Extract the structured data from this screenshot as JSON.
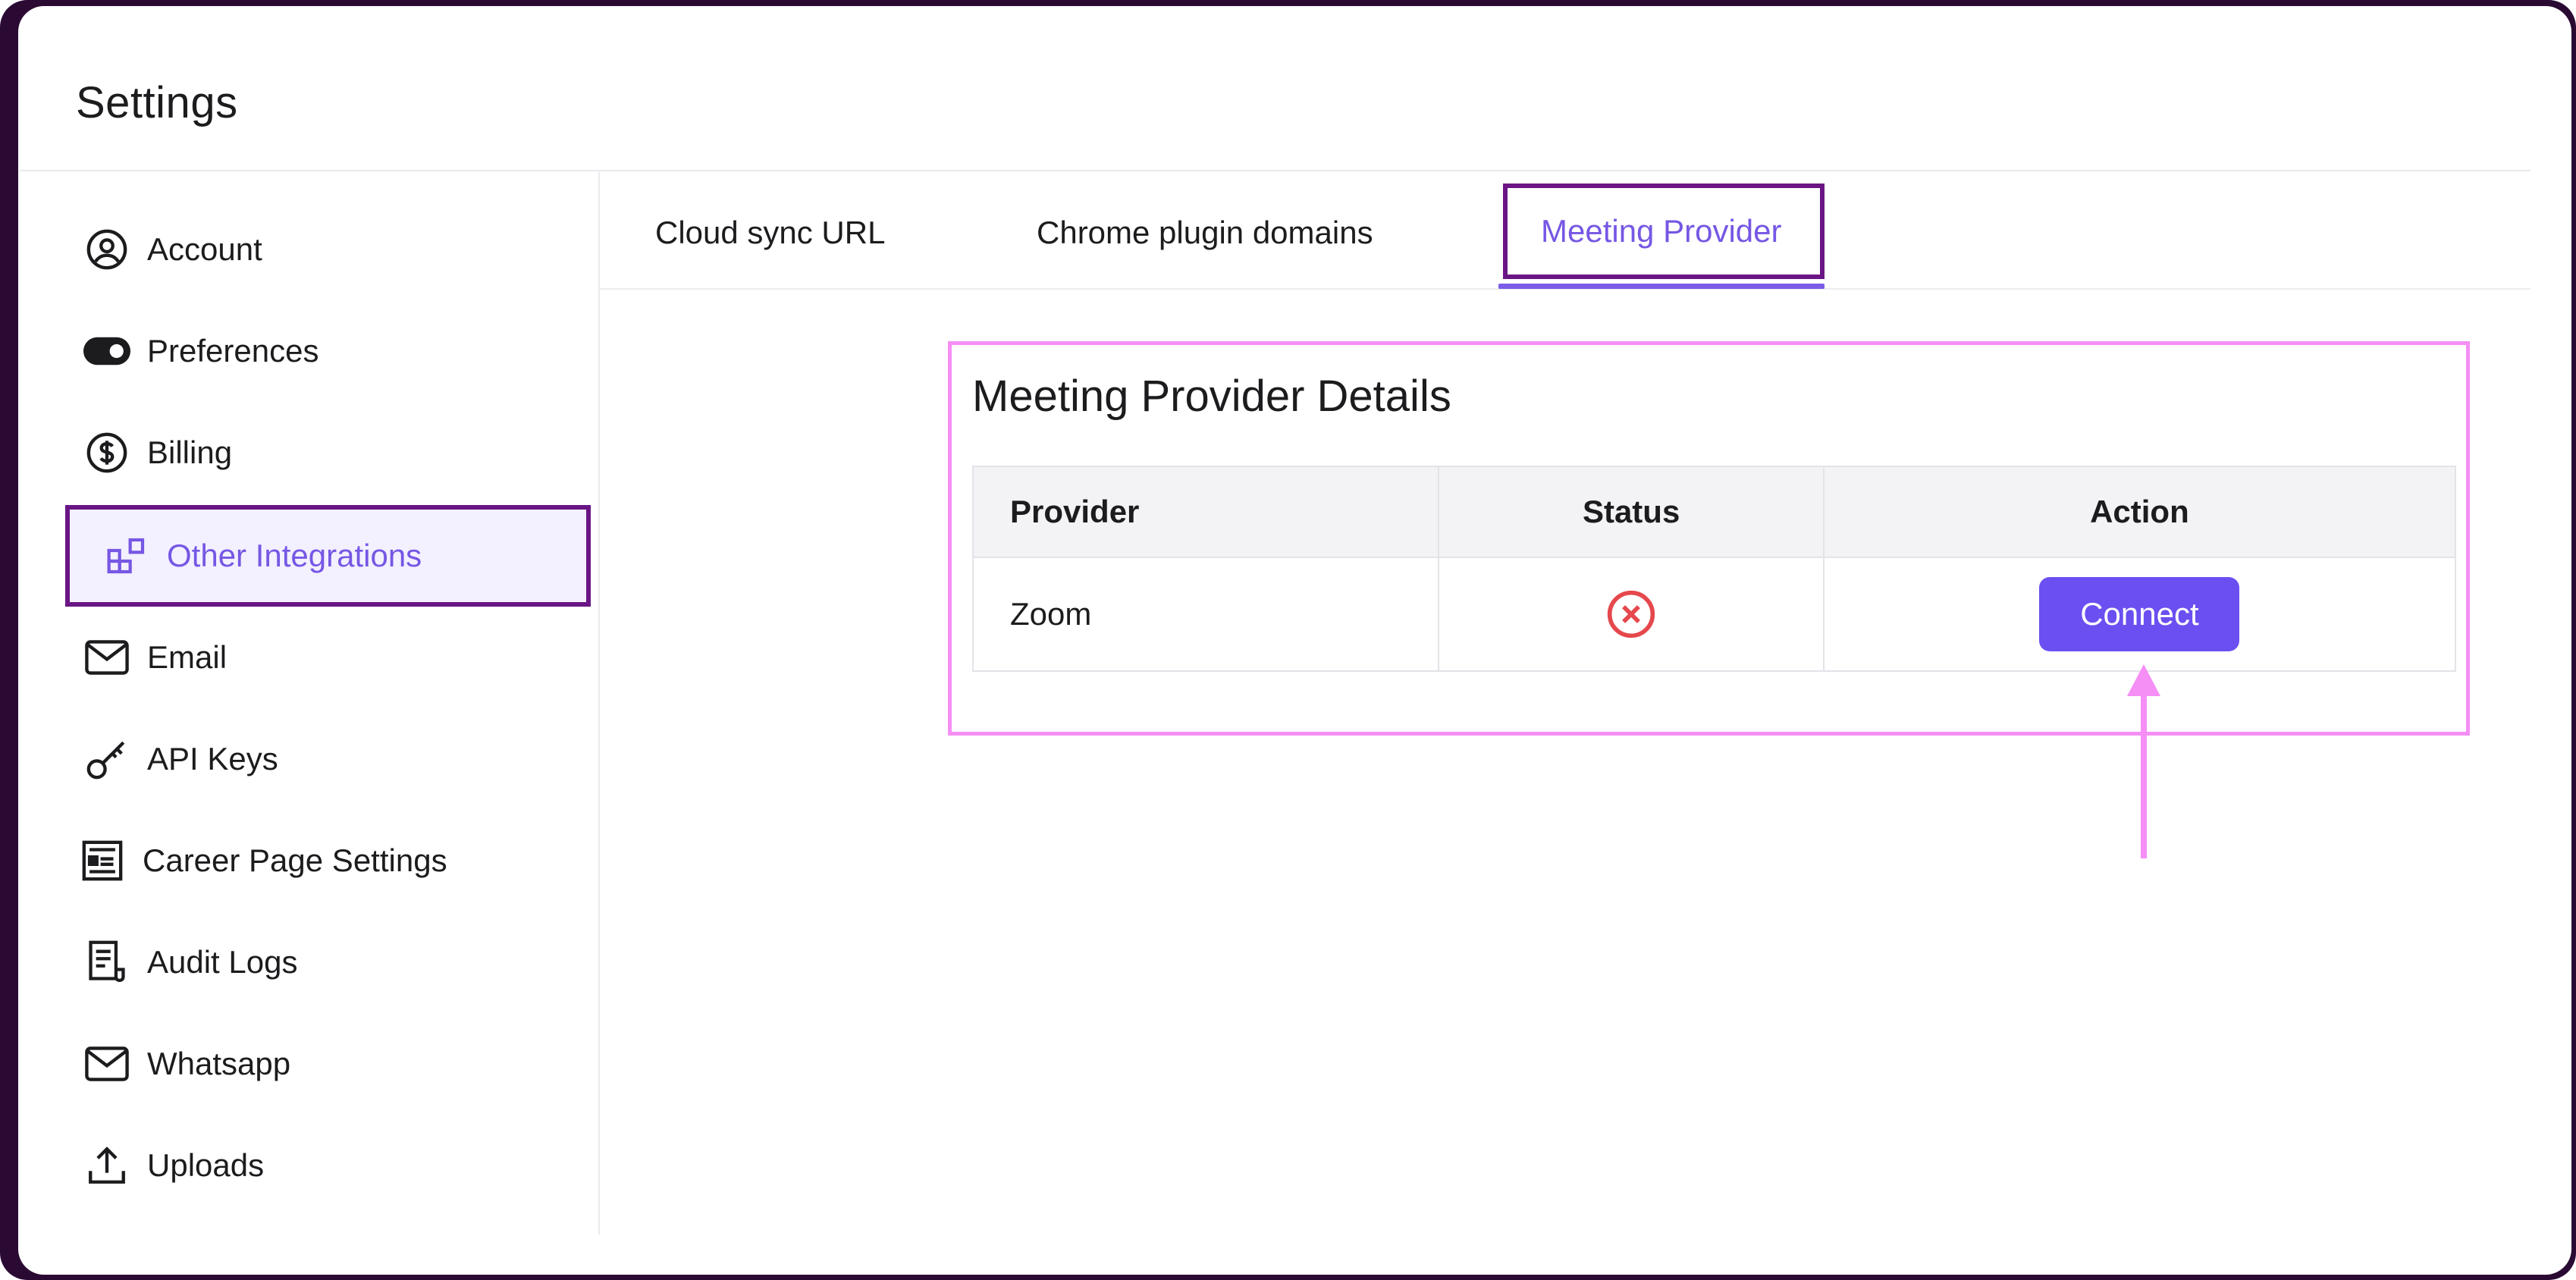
{
  "page": {
    "title": "Settings"
  },
  "sidebar": {
    "items": [
      {
        "label": "Account",
        "icon": "user-circle-icon",
        "active": false
      },
      {
        "label": "Preferences",
        "icon": "toggle-icon",
        "active": false
      },
      {
        "label": "Billing",
        "icon": "dollar-circle-icon",
        "active": false
      },
      {
        "label": "Other Integrations",
        "icon": "integrations-icon",
        "active": true
      },
      {
        "label": "Email",
        "icon": "mail-icon",
        "active": false
      },
      {
        "label": "API Keys",
        "icon": "key-icon",
        "active": false
      },
      {
        "label": "Career Page Settings",
        "icon": "form-icon",
        "active": false
      },
      {
        "label": "Audit Logs",
        "icon": "log-icon",
        "active": false
      },
      {
        "label": "Whatsapp",
        "icon": "mail-icon",
        "active": false
      },
      {
        "label": "Uploads",
        "icon": "upload-icon",
        "active": false
      }
    ]
  },
  "tabs": [
    {
      "label": "Cloud sync URL",
      "active": false
    },
    {
      "label": "Chrome plugin domains",
      "active": false
    },
    {
      "label": "Meeting Provider",
      "active": true
    }
  ],
  "meeting_provider": {
    "title": "Meeting Provider Details",
    "columns": [
      "Provider",
      "Status",
      "Action"
    ],
    "rows": [
      {
        "provider": "Zoom",
        "status": "not-connected",
        "status_icon": "x-circle-icon",
        "action_label": "Connect"
      }
    ]
  },
  "colors": {
    "accent": "#7657e4",
    "button": "#6b4ff0",
    "highlight_box": "#f58ef5",
    "active_border": "#6b1585",
    "status_error": "#e5484d"
  }
}
